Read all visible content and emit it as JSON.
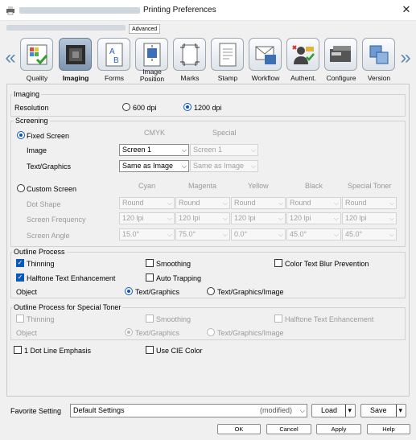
{
  "title": "Printing Preferences",
  "subheader": {
    "tab": "Advanced"
  },
  "tabs": [
    {
      "label": "Quality",
      "icon": "quality-icon"
    },
    {
      "label": "Imaging",
      "icon": "imaging-icon",
      "selected": true
    },
    {
      "label": "Forms",
      "icon": "forms-icon"
    },
    {
      "label": "Image Position",
      "icon": "image-position-icon"
    },
    {
      "label": "Marks",
      "icon": "marks-icon"
    },
    {
      "label": "Stamp",
      "icon": "stamp-icon"
    },
    {
      "label": "Workflow",
      "icon": "workflow-icon"
    },
    {
      "label": "Authent.",
      "icon": "authentication-icon"
    },
    {
      "label": "Configure",
      "icon": "configure-icon"
    },
    {
      "label": "Version",
      "icon": "version-icon"
    }
  ],
  "imaging": {
    "group_label": "Imaging",
    "resolution_label": "Resolution",
    "res_600": "600 dpi",
    "res_1200": "1200 dpi",
    "selected_resolution": "1200 dpi"
  },
  "screening": {
    "group_label": "Screening",
    "fixed_screen": "Fixed Screen",
    "col_cmyk": "CMYK",
    "col_special": "Special",
    "image_label": "Image",
    "textgraphics_label": "Text/Graphics",
    "image_cmyk": "Screen 1",
    "image_special": "Screen 1",
    "text_cmyk": "Same as Image",
    "text_special": "Same as Image",
    "custom_screen": "Custom Screen",
    "cols": [
      "Cyan",
      "Magenta",
      "Yellow",
      "Black",
      "Special Toner"
    ],
    "dot_shape_label": "Dot Shape",
    "screen_freq_label": "Screen Frequency",
    "screen_angle_label": "Screen Angle",
    "dot_shape": [
      "Round",
      "Round",
      "Round",
      "Round",
      "Round"
    ],
    "frequency": [
      "120 lpi",
      "120 lpi",
      "120 lpi",
      "120 lpi",
      "120 lpi"
    ],
    "angle": [
      "15.0°",
      "75.0°",
      "0.0°",
      "45.0°",
      "45.0°"
    ]
  },
  "outline": {
    "group_label": "Outline Process",
    "thinning": "Thinning",
    "smoothing": "Smoothing",
    "color_blur": "Color Text Blur Prevention",
    "halftone": "Halftone Text Enhancement",
    "auto_trapping": "Auto Trapping",
    "object_label": "Object",
    "obj_text": "Text/Graphics",
    "obj_text_image": "Text/Graphics/Image"
  },
  "outline_special": {
    "group_label": "Outline Process for Special Toner",
    "thinning": "Thinning",
    "smoothing": "Smoothing",
    "halftone": "Halftone Text Enhancement",
    "object_label": "Object",
    "obj_text": "Text/Graphics",
    "obj_text_image": "Text/Graphics/Image"
  },
  "extra": {
    "dot_line": "1 Dot Line Emphasis",
    "cie_color": "Use CIE Color"
  },
  "favorite": {
    "label": "Favorite Setting",
    "value": "Default Settings",
    "modified": "(modified)",
    "load": "Load",
    "save": "Save"
  },
  "footer": {
    "ok": "OK",
    "cancel": "Cancel",
    "apply": "Apply",
    "help": "Help"
  },
  "colors": {
    "accent": "#0a58ba",
    "tab_selected": "#8ea3bd"
  }
}
